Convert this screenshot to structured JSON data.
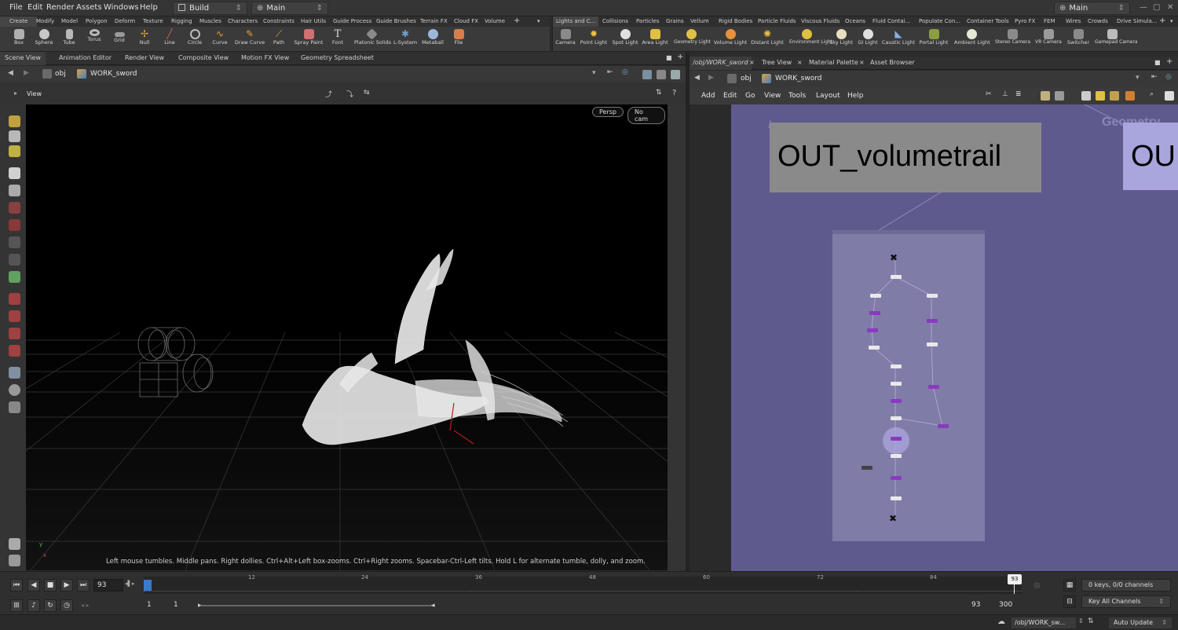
{
  "menu": [
    "File",
    "Edit",
    "Render",
    "Assets",
    "Windows",
    "Help"
  ],
  "desktop": {
    "build": "Build",
    "main": "Main",
    "right_main": "Main"
  },
  "shelf_left": {
    "tabs": [
      "Create",
      "Modify",
      "Model",
      "Polygon",
      "Deform",
      "Texture",
      "Rigging",
      "Muscles",
      "Characters",
      "Constraints",
      "Hair Utils",
      "Guide Process",
      "Guide Brushes",
      "Terrain FX",
      "Cloud FX",
      "Volume"
    ],
    "tools": [
      "Box",
      "Sphere",
      "Tube",
      "Torus",
      "Grid",
      "Null",
      "Line",
      "Circle",
      "Curve",
      "Draw Curve",
      "Path",
      "Spray Paint",
      "Font",
      "Platonic Solids",
      "L-System",
      "Metaball",
      "File"
    ]
  },
  "shelf_right": {
    "tabs": [
      "Lights and C...",
      "Collisions",
      "Particles",
      "Grains",
      "Vellum",
      "Rigid Bodies",
      "Particle Fluids",
      "Viscous Fluids",
      "Oceans",
      "Fluid Contai...",
      "Populate Con...",
      "Container Tools",
      "Pyro FX",
      "FEM",
      "Wires",
      "Crowds",
      "Drive Simula..."
    ],
    "tools": [
      "Camera",
      "Point Light",
      "Spot Light",
      "Area Light",
      "Geometry Light",
      "Volume Light",
      "Distant Light",
      "Environment Light",
      "Sky Light",
      "GI Light",
      "Caustic Light",
      "Portal Light",
      "Ambient Light",
      "Stereo Camera",
      "VR Camera",
      "Switcher",
      "Gamepad Camera"
    ]
  },
  "left_pane": {
    "tabs": [
      "Scene View",
      "Animation Editor",
      "Render View",
      "Composite View",
      "Motion FX View",
      "Geometry Spreadsheet"
    ],
    "path_root": "obj",
    "path_node": "WORK_sword",
    "view_label": "View",
    "persp": "Persp",
    "nocam": "No cam",
    "hint": "Left mouse tumbles. Middle pans. Right dollies. Ctrl+Alt+Left box-zooms. Ctrl+Right zooms. Spacebar-Ctrl-Left tilts. Hold L for alternate tumble, dolly, and zoom.",
    "axis_y": "y",
    "axis_x": "x"
  },
  "right_pane": {
    "tabs": [
      "/obj/WORK_sword",
      "Tree View",
      "Material Palette",
      "Asset Browser"
    ],
    "path_root": "obj",
    "path_node": "WORK_sword",
    "menu": [
      "Add",
      "Edit",
      "Go",
      "View",
      "Tools",
      "Layout",
      "Help"
    ],
    "sticky1": "OUT_volumetrail",
    "sticky2": "OU",
    "geo_label": "Geometry"
  },
  "timeline": {
    "current_frame": "93",
    "ticks": [
      "12",
      "24",
      "36",
      "48",
      "60",
      "72",
      "84"
    ],
    "frame_marker": "93",
    "start": "1",
    "start2": "1",
    "end": "93",
    "end2": "300",
    "keys": "0 keys, 0/0 channels",
    "key_all": "Key All Channels"
  },
  "status": {
    "path": "/obj/WORK_sw...",
    "auto_update": "Auto Update"
  }
}
